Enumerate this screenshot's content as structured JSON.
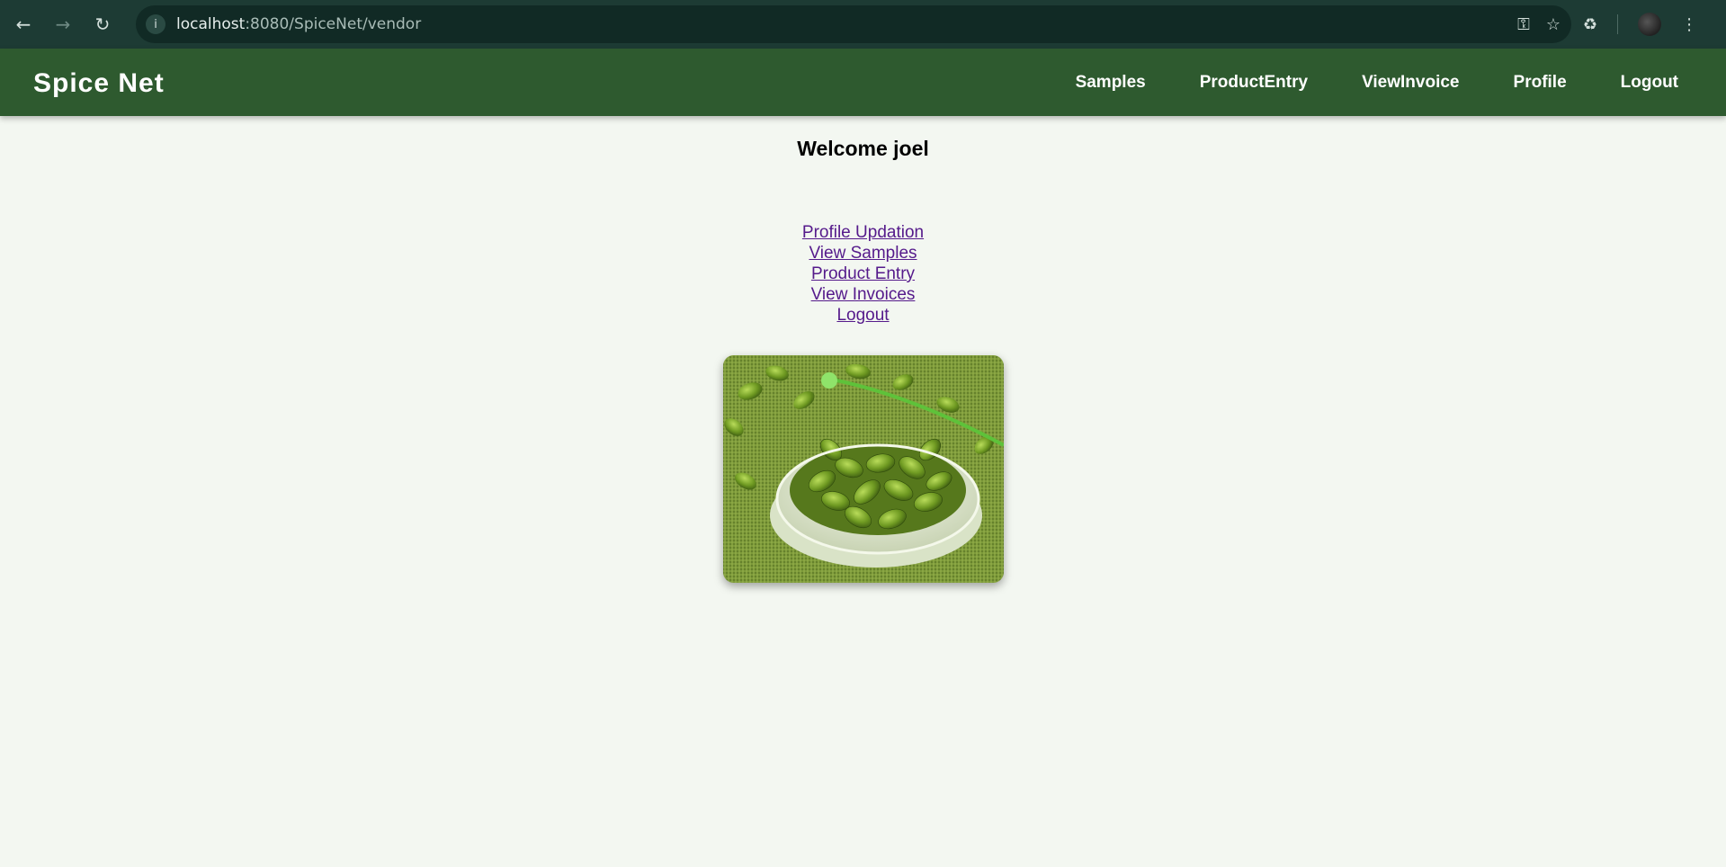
{
  "browser": {
    "url_host": "localhost",
    "url_rest": ":8080/SpiceNet/vendor",
    "back_icon": "back-arrow-icon",
    "forward_icon": "forward-arrow-icon",
    "reload_icon": "reload-icon"
  },
  "header": {
    "brand": "Spice Net",
    "nav": [
      "Samples",
      "ProductEntry",
      "ViewInvoice",
      "Profile",
      "Logout"
    ]
  },
  "main": {
    "welcome": "Welcome joel",
    "links": [
      "Profile Updation",
      "View Samples",
      "Product Entry",
      "View Invoices",
      "Logout"
    ]
  },
  "colors": {
    "header_bg": "#2e5a2f",
    "page_bg": "#f3f7f1",
    "link": "#551a8b"
  }
}
